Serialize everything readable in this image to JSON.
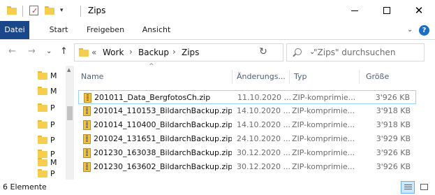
{
  "window": {
    "title": "Zips",
    "minimize_label": "",
    "maximize_label": "",
    "close_glyph": "✕"
  },
  "ribbon": {
    "tabs": [
      "Datei",
      "Start",
      "Freigeben",
      "Ansicht"
    ],
    "active_tab": "Datei",
    "accent_color": "#19478a",
    "expand_glyph": "⌄",
    "help_glyph": "?"
  },
  "nav": {
    "back_glyph": "←",
    "forward_glyph": "→",
    "recent_glyph": "⌄",
    "up_glyph": "↑",
    "breadcrumb_overflow": "«",
    "breadcrumb": [
      "Work",
      "Backup",
      "Zips"
    ],
    "breadcrumb_separator": "›",
    "address_dropdown_glyph": "⌄",
    "refresh_glyph": "↻",
    "search_placeholder": "\"Zips\" durchsuchen"
  },
  "navpane": {
    "items": [
      {
        "label": "M",
        "icon": "folder-icon"
      },
      {
        "label": "M",
        "icon": "folder-icon"
      },
      {
        "label": "P",
        "icon": "folder-icon"
      },
      {
        "label": "P",
        "icon": "folder-icon"
      },
      {
        "label": "P",
        "icon": "folder-icon"
      },
      {
        "label": "P",
        "icon": "folder-icon"
      },
      {
        "label": "M",
        "icon": "shortcut-icon"
      },
      {
        "label": "P",
        "icon": "folder-icon"
      },
      {
        "label": "P",
        "icon": "folder-icon"
      }
    ]
  },
  "list": {
    "columns": {
      "name": "Name",
      "date": "Änderungs...",
      "type": "Typ",
      "size": "Größe"
    },
    "sort_indicator": "^",
    "rows": [
      {
        "name": "201011_Data_BergfotosCh.zip",
        "date": "11.10.2020 ...",
        "type": "ZIP-komprimie...",
        "size": "3'926 KB",
        "selected": true
      },
      {
        "name": "201014_110153_BildarchBackup.zip",
        "date": "14.10.2020 ...",
        "type": "ZIP-komprimie...",
        "size": "3'918 KB",
        "selected": false
      },
      {
        "name": "201014_110400_BildarchBackup.zip",
        "date": "14.10.2020 ...",
        "type": "ZIP-komprimie...",
        "size": "3'918 KB",
        "selected": false
      },
      {
        "name": "201024_131651_BildarchBackup.zip",
        "date": "24.10.2020 ...",
        "type": "ZIP-komprimie...",
        "size": "3'929 KB",
        "selected": false
      },
      {
        "name": "201230_163038_BildarchBackup.zip",
        "date": "30.12.2020 ...",
        "type": "ZIP-komprimie...",
        "size": "3'926 KB",
        "selected": false
      },
      {
        "name": "201230_163602_BildarchBackup.zip",
        "date": "30.12.2020 ...",
        "type": "ZIP-komprimie...",
        "size": "3'926 KB",
        "selected": false
      }
    ]
  },
  "status": {
    "item_count": "6 Elemente",
    "active_view": "details"
  }
}
